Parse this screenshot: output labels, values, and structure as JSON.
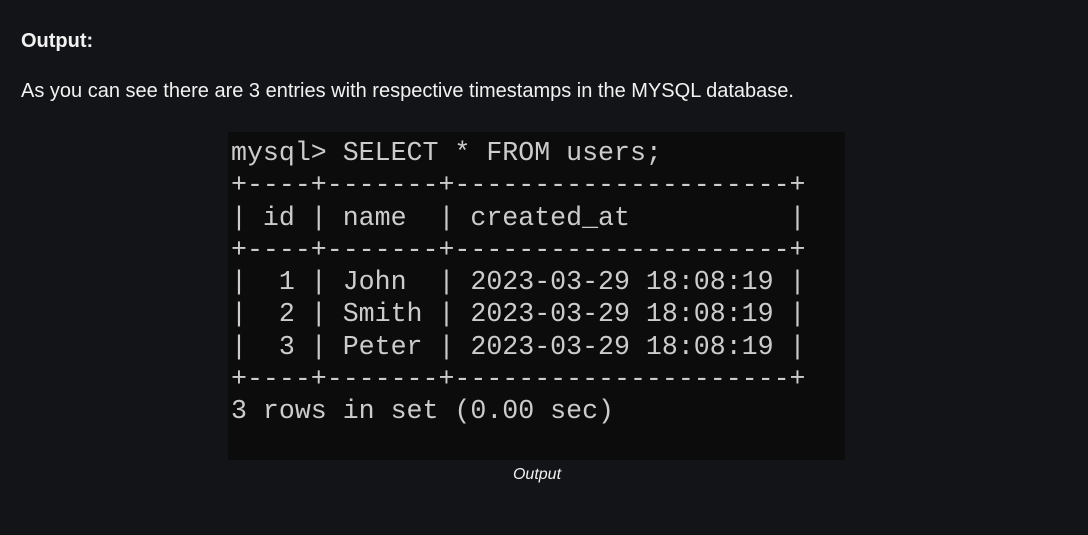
{
  "heading": "Output:",
  "paragraph": "As you can see there are 3 entries with respective timestamps in the MYSQL database.",
  "terminal": {
    "lines": [
      "mysql> SELECT * FROM users;",
      "+----+-------+---------------------+",
      "| id | name  | created_at          |",
      "+----+-------+---------------------+",
      "|  1 | John  | 2023-03-29 18:08:19 |",
      "|  2 | Smith | 2023-03-29 18:08:19 |",
      "|  3 | Peter | 2023-03-29 18:08:19 |",
      "+----+-------+---------------------+",
      "3 rows in set (0.00 sec)"
    ]
  },
  "caption": "Output"
}
